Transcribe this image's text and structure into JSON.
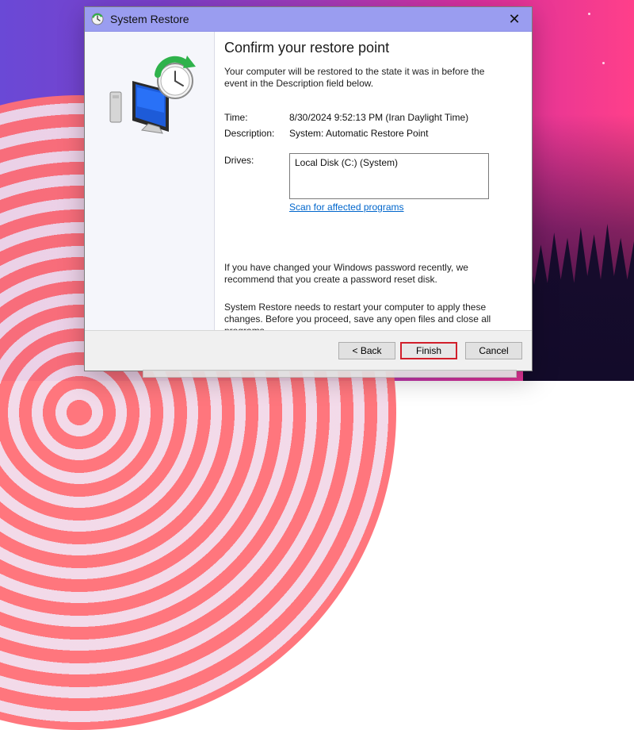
{
  "window": {
    "title": "System Restore",
    "close_icon": "close-icon",
    "title_icon": "system-restore-icon"
  },
  "main": {
    "heading": "Confirm your restore point",
    "intro": "Your computer will be restored to the state it was in before the event in the Description field below.",
    "fields": {
      "time_label": "Time:",
      "time_value": "8/30/2024 9:52:13 PM (Iran Daylight Time)",
      "description_label": "Description:",
      "description_value": "System: Automatic Restore Point"
    },
    "drives": {
      "label": "Drives:",
      "items": [
        "Local Disk (C:) (System)"
      ],
      "scan_link": "Scan for affected programs"
    },
    "note_password": "If you have changed your Windows password recently, we recommend that you create a password reset disk.",
    "note_restart": "System Restore needs to restart your computer to apply these changes. Before you proceed, save any open files and close all programs."
  },
  "buttons": {
    "back": "< Back",
    "finish": "Finish",
    "cancel": "Cancel"
  },
  "colors": {
    "titlebar": "#9a9df0",
    "link": "#0066cc",
    "finish_highlight": "#d11f2b"
  }
}
